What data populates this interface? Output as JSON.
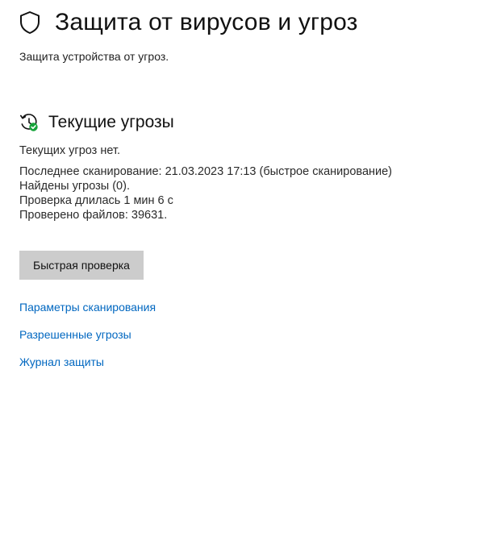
{
  "header": {
    "title": "Защита от вирусов и угроз",
    "icon": "shield-icon"
  },
  "subtitle": "Защита устройства от угроз.",
  "current_threats": {
    "icon": "scan-history-check-icon",
    "title": "Текущие угрозы",
    "status": "Текущих угроз нет.",
    "last_scan": "Последнее сканирование: 21.03.2023 17:13 (быстрое сканирование)",
    "threats_found": "Найдены угрозы (0).",
    "duration": "Проверка длилась 1 мин 6 с",
    "files_checked": "Проверено файлов: 39631."
  },
  "actions": {
    "quick_scan_label": "Быстрая проверка"
  },
  "links": {
    "scan_options": "Параметры сканирования",
    "allowed_threats": "Разрешенные угрозы",
    "protection_history": "Журнал защиты"
  },
  "colors": {
    "link": "#0067c0",
    "button_bg": "#cccccc",
    "status_ok": "#16a33a"
  }
}
